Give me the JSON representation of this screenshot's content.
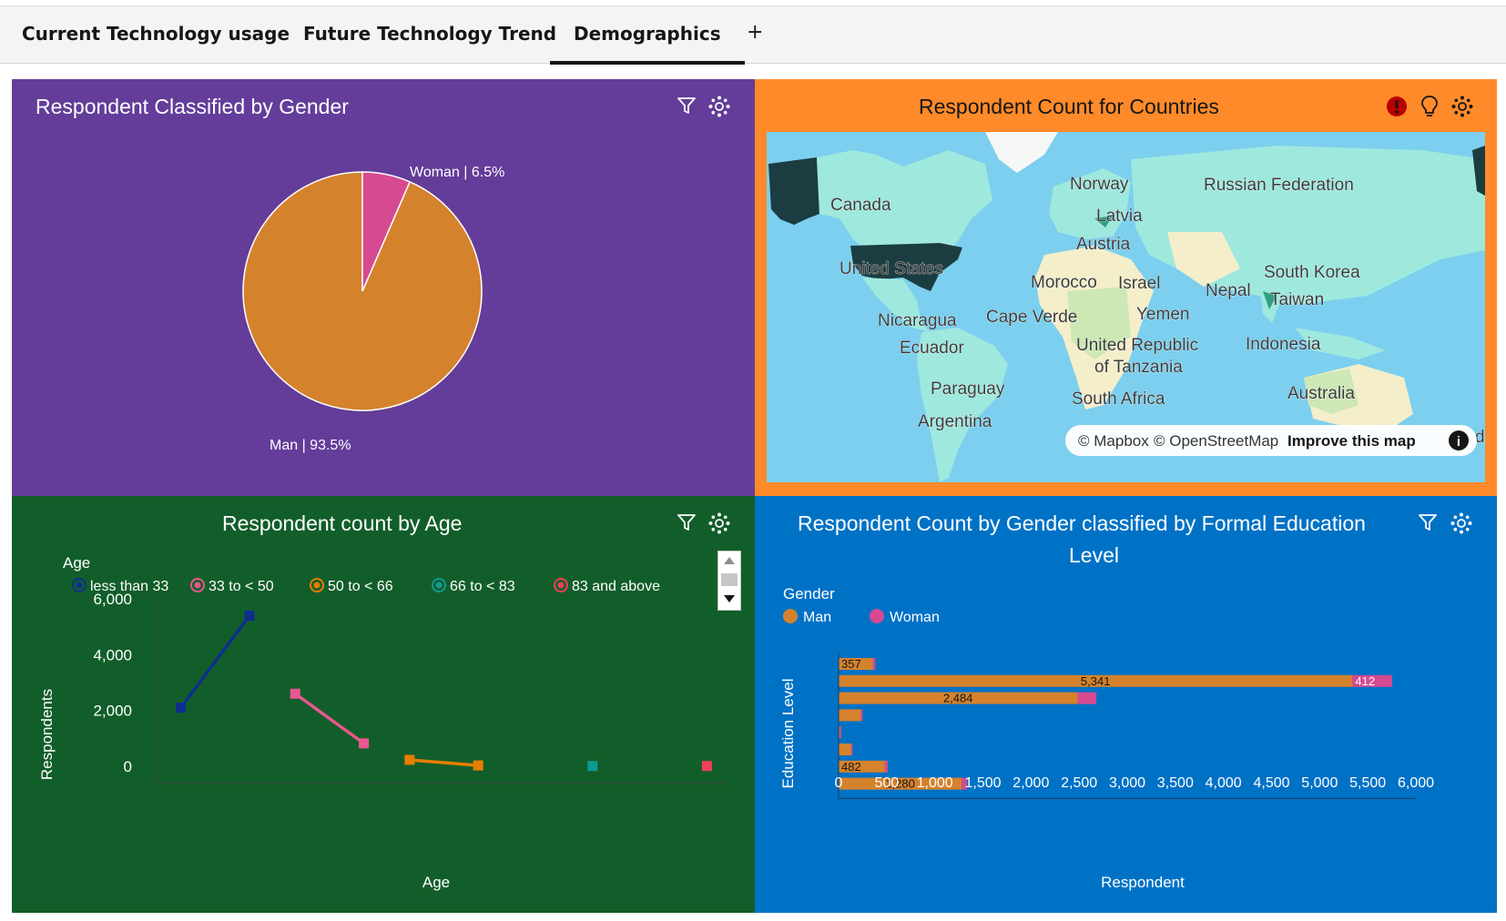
{
  "tabs": [
    {
      "label": "Current Technology usage"
    },
    {
      "label": "Future Technology Trend"
    },
    {
      "label": "Demographics",
      "active": true
    }
  ],
  "add_tab_label": "+",
  "colors": {
    "purple_panel": "#633d99",
    "orange_panel": "#ff8a2a",
    "green_panel": "#125e2a",
    "blue_panel": "#0072c6",
    "man": "#d5822d",
    "woman": "#d64a91",
    "age_less_33": "#0d2f8f",
    "age_33_50": "#e8578f",
    "age_50_66": "#e67e00",
    "age_66_83": "#0d9a90",
    "age_83_above": "#f0405a"
  },
  "gender_panel": {
    "title": "Respondent Classified by Gender",
    "icons": [
      "filter-icon",
      "settings-icon"
    ],
    "chart_data": {
      "type": "pie",
      "categories": [
        "Man",
        "Woman"
      ],
      "values": [
        93.5,
        6.5
      ],
      "labels": [
        "Man | 93.5%",
        "Woman | 6.5%"
      ]
    }
  },
  "map_panel": {
    "title": "Respondent Count for Countries",
    "icons": [
      "alert-icon",
      "lightbulb-icon",
      "settings-icon"
    ],
    "country_labels": [
      "Canada",
      "Norway",
      "Russian Federation",
      "Latvia",
      "Austria",
      "United States",
      "Morocco",
      "Israel",
      "South Korea",
      "Nepal",
      "Taiwan",
      "Yemen",
      "Nicaragua",
      "Cape Verde",
      "Ecuador",
      "United Republic",
      "of Tanzania",
      "Indonesia",
      "Paraguay",
      "South Africa",
      "Australia",
      "Argentina",
      "d"
    ],
    "attribution": {
      "mapbox": "© Mapbox",
      "osm": "© OpenStreetMap",
      "improve": "Improve this map",
      "info_glyph": "i"
    }
  },
  "age_panel": {
    "title": "Respondent count by Age",
    "icons": [
      "filter-icon",
      "settings-icon"
    ],
    "legend_title": "Age",
    "chart_data": {
      "type": "line",
      "xlabel": "Age",
      "ylabel": "Respondents",
      "ylim": [
        0,
        6000
      ],
      "yticks": [
        "6,000",
        "4,000",
        "2,000",
        "0"
      ],
      "grid": false,
      "legend": "top",
      "series": [
        {
          "name": "less than 33",
          "values": [
            2100,
            5400
          ]
        },
        {
          "name": "33 to < 50",
          "values": [
            2600,
            820
          ]
        },
        {
          "name": "50 to < 66",
          "values": [
            230,
            30
          ]
        },
        {
          "name": "66 to < 83",
          "values": [
            10
          ]
        },
        {
          "name": "83 and above",
          "values": [
            10
          ]
        }
      ]
    }
  },
  "education_panel": {
    "title_line1": "Respondent Count by Gender classified by Formal Education",
    "title_line2": "Level",
    "icons": [
      "filter-icon",
      "settings-icon"
    ],
    "legend_title": "Gender",
    "chart_data": {
      "type": "bar",
      "orientation": "horizontal",
      "stacked": true,
      "xlabel": "Respondent",
      "ylabel": "Education Level",
      "xlim": [
        0,
        6000
      ],
      "xticks": [
        "0",
        "500",
        "1,000",
        "1,500",
        "2,000",
        "2,500",
        "3,000",
        "3,500",
        "4,000",
        "4,500",
        "5,000",
        "5,500",
        "6,000"
      ],
      "series": [
        {
          "name": "Man",
          "values": [
            357,
            5341,
            2484,
            230,
            12,
            130,
            482,
            1280
          ]
        },
        {
          "name": "Woman",
          "values": [
            25,
            412,
            195,
            20,
            2,
            10,
            30,
            55
          ]
        }
      ],
      "data_labels": [
        {
          "series": 0,
          "index": 0,
          "text": "357"
        },
        {
          "series": 0,
          "index": 1,
          "text": "5,341"
        },
        {
          "series": 1,
          "index": 1,
          "text": "412"
        },
        {
          "series": 0,
          "index": 2,
          "text": "2,484"
        },
        {
          "series": 0,
          "index": 6,
          "text": "482"
        },
        {
          "series": 0,
          "index": 7,
          "text": "1,280"
        }
      ]
    }
  }
}
